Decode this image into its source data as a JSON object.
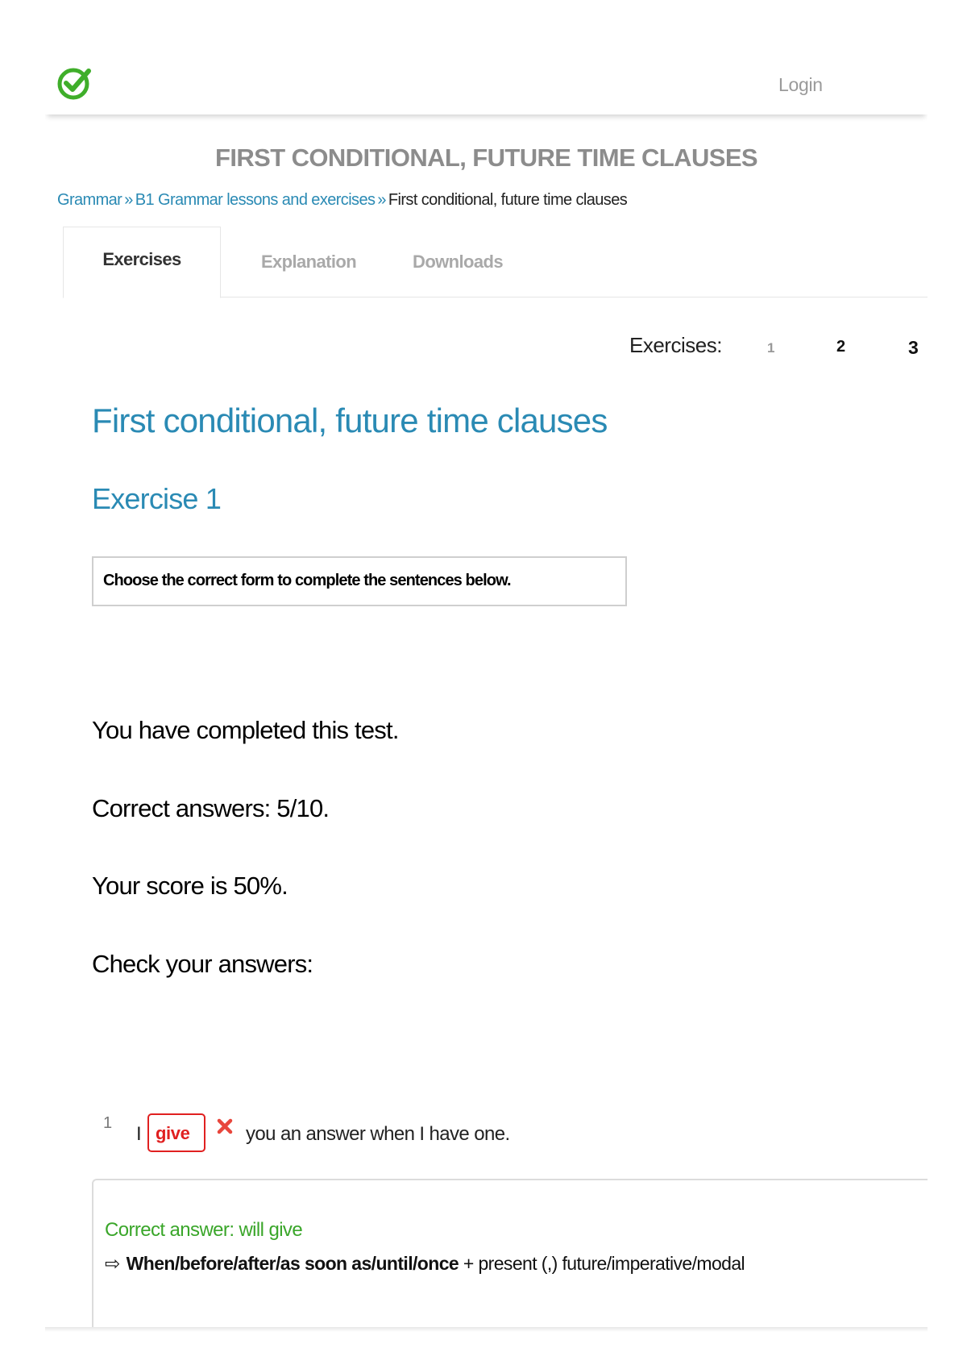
{
  "header": {
    "logo_icon": "checkmark-circle-icon",
    "login_label": "Login"
  },
  "page_title": "FIRST CONDITIONAL, FUTURE TIME CLAUSES",
  "breadcrumb": {
    "items": [
      "Grammar",
      "B1 Grammar lessons and exercises",
      "First conditional, future time clauses"
    ],
    "separator": "»"
  },
  "tabs": [
    {
      "label": "Exercises",
      "active": true
    },
    {
      "label": "Explanation",
      "active": false
    },
    {
      "label": "Downloads",
      "active": false
    }
  ],
  "pager": {
    "label": "Exercises:",
    "pages": [
      "1",
      "2",
      "3"
    ],
    "current": "1"
  },
  "main_title": "First conditional, future time clauses",
  "exercise_heading": "Exercise 1",
  "instruction": "Choose the correct form to complete the sentences below.",
  "results": {
    "completed": "You have completed this test.",
    "correct_answers": "Correct answers: 5/10.",
    "score": "Your score is 50%.",
    "check": "Check your answers:"
  },
  "question": {
    "number": "1",
    "before": "I",
    "given_answer": "give",
    "status_icon": "wrong-x-icon",
    "after": "you an answer when I have one.",
    "correct_answer": "Correct answer: will give",
    "rule_arrow": "⇨",
    "rule_bold": "When/before/after/as soon as/until/once",
    "rule_rest": " + present (,) future/imperative/modal"
  },
  "colors": {
    "accent_blue": "#2a8ab4",
    "logo_green": "#3fae2a",
    "wrong_red": "#e02020",
    "correct_green": "#3aa62a",
    "muted_gray": "#8c8c8c"
  }
}
